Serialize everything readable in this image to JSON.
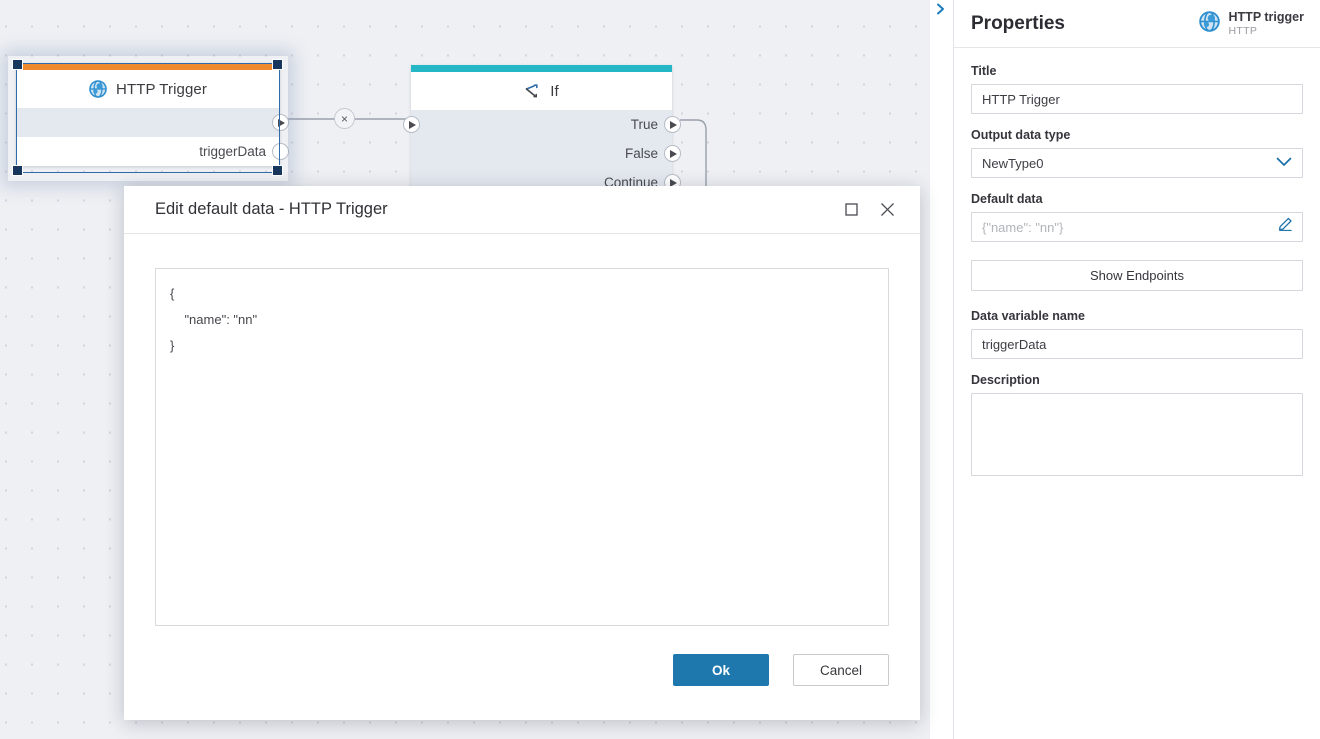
{
  "canvas": {
    "nodes": [
      {
        "id": "http-trigger",
        "title": "HTTP Trigger",
        "accent_color": "#f08a2e",
        "icon": "globe-icon",
        "selected": true,
        "rows": [
          {
            "type": "exec",
            "label": ""
          },
          {
            "type": "data",
            "label": "triggerData"
          }
        ]
      },
      {
        "id": "if",
        "title": "If",
        "accent_color": "#26b7c7",
        "icon": "branch-icon",
        "selected": false,
        "rows": [
          {
            "type": "exec",
            "label": "True"
          },
          {
            "type": "exec",
            "label": "False"
          },
          {
            "type": "exec",
            "label": "Continue"
          }
        ]
      }
    ],
    "connector_delete_label": "×"
  },
  "dialog": {
    "title": "Edit default data - HTTP Trigger",
    "maximize_icon": "maximize-icon",
    "close_icon": "close-icon",
    "editor_value": "{\n    \"name\": \"nn\"\n}",
    "ok_label": "Ok",
    "cancel_label": "Cancel"
  },
  "panel": {
    "collapse_icon": "chevron-right-icon",
    "title": "Properties",
    "node_icon": "globe-icon",
    "node_name": "HTTP trigger",
    "node_type": "HTTP",
    "fields": {
      "title_label": "Title",
      "title_value": "HTTP Trigger",
      "output_type_label": "Output data type",
      "output_type_value": "NewType0",
      "output_type_chevron": "chevron-down-icon",
      "default_data_label": "Default data",
      "default_data_placeholder": "{\"name\": \"nn\"}",
      "default_data_edit_icon": "pencil-icon",
      "show_endpoints_label": "Show Endpoints",
      "data_var_label": "Data variable name",
      "data_var_value": "triggerData",
      "description_label": "Description",
      "description_value": ""
    }
  },
  "colors": {
    "canvas_bg": "#eef0f4",
    "primary_button": "#1e78ae",
    "trigger_accent": "#f08a2e",
    "if_accent": "#26b7c7",
    "selection": "#17365d"
  }
}
